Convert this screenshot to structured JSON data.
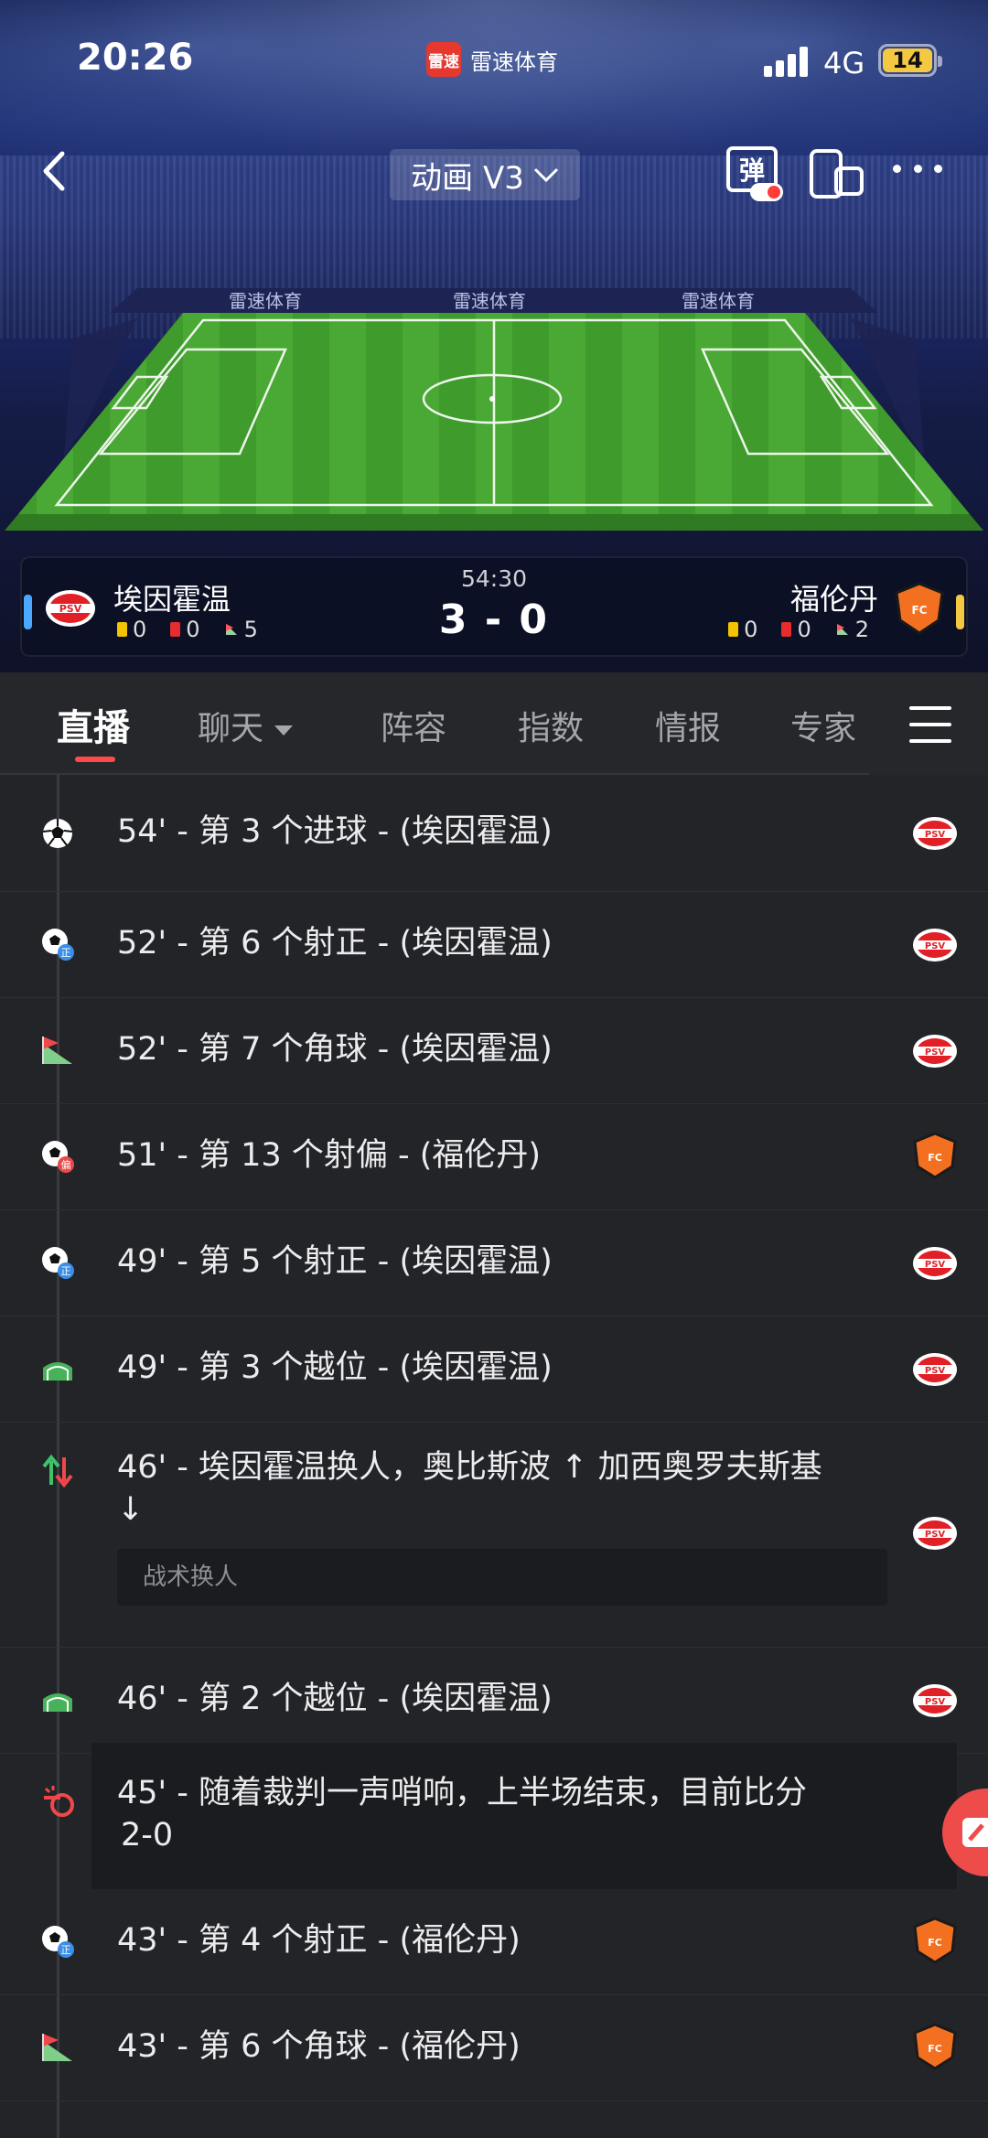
{
  "status_bar": {
    "time": "20:26",
    "app_name": "雷速体育",
    "app_logo_text": "雷速",
    "network": "4G",
    "battery": "14"
  },
  "nav": {
    "mode_label": "动画 V3",
    "danmu_label": "弹"
  },
  "stadium": {
    "ad_text": "雷速体育"
  },
  "match": {
    "clock": "54:30",
    "score": "3 - 0",
    "home": {
      "name": "埃因霍温",
      "crest_text": "PSV",
      "yellow": "0",
      "red": "0",
      "corners": "5"
    },
    "away": {
      "name": "福伦丹",
      "crest_text": "FC",
      "yellow": "0",
      "red": "0",
      "corners": "2"
    }
  },
  "tabs": [
    {
      "label": "直播"
    },
    {
      "label": "聊天"
    },
    {
      "label": "阵容"
    },
    {
      "label": "指数"
    },
    {
      "label": "情报"
    },
    {
      "label": "专家"
    }
  ],
  "events": [
    {
      "text": "54' - 第 3 个进球 - (埃因霍温)",
      "icon": "goal-icon",
      "team": "home"
    },
    {
      "text": "52' - 第 6 个射正 - (埃因霍温)",
      "icon": "shot-on-target-icon",
      "team": "home"
    },
    {
      "text": "52' - 第 7 个角球 - (埃因霍温)",
      "icon": "corner-icon",
      "team": "home"
    },
    {
      "text": "51' - 第 13 个射偏 - (福伦丹)",
      "icon": "shot-off-target-icon",
      "team": "away"
    },
    {
      "text": "49' - 第 5 个射正 - (埃因霍温)",
      "icon": "shot-on-target-icon",
      "team": "home"
    },
    {
      "text": "49' - 第 3 个越位 - (埃因霍温)",
      "icon": "offside-icon",
      "team": "home"
    },
    {
      "text_line1": "46' - 埃因霍温换人，奥比斯波 ↑ 加西奥罗夫斯基",
      "text_line2": "↓",
      "note": "战术换人",
      "icon": "substitution-icon",
      "team": "home"
    },
    {
      "text": "46' - 第 2 个越位 - (埃因霍温)",
      "icon": "offside-icon",
      "team": "home"
    },
    {
      "text_line1": "45' - 随着裁判一声哨响，上半场结束，目前比分",
      "text_line2": "2-0",
      "icon": "whistle-icon",
      "team": ""
    },
    {
      "text": "43' - 第 4 个射正 - (福伦丹)",
      "icon": "shot-on-target-icon",
      "team": "away"
    },
    {
      "text": "43' - 第 6 个角球 - (福伦丹)",
      "icon": "corner-icon",
      "team": "away"
    }
  ],
  "colors": {
    "accent": "#ff4a4a",
    "home": "#4aa8ff",
    "away": "#f5c842",
    "background": "#232428"
  }
}
